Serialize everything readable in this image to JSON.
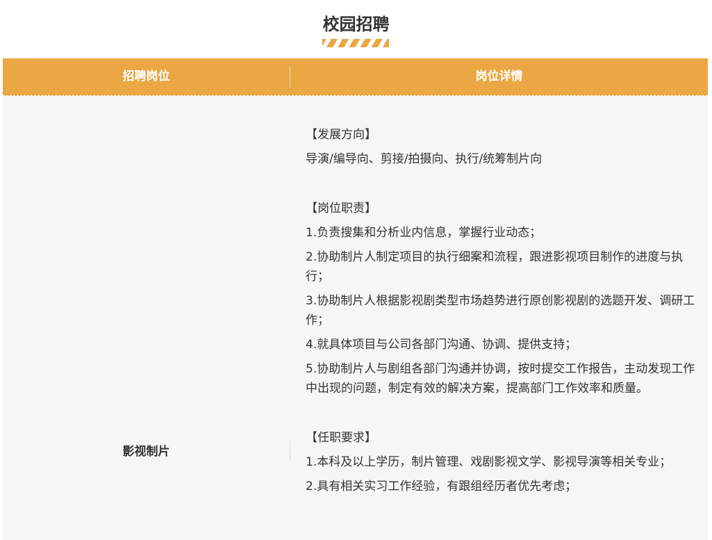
{
  "page": {
    "title": "校园招聘"
  },
  "table": {
    "headers": {
      "position": "招聘岗位",
      "details": "岗位详情"
    },
    "row": {
      "position": "影视制片",
      "direction_heading": "【发展方向】",
      "direction_text": "导演/编导向、剪接/拍摄向、执行/统筹制片向",
      "duties_heading": "【岗位职责】",
      "duties": [
        "1.负责搜集和分析业内信息，掌握行业动态；",
        "2.协助制片人制定项目的执行细案和流程，跟进影视项目制作的进度与执行；",
        "3.协助制片人根据影视剧类型市场趋势进行原创影视剧的选题开发、调研工作；",
        "4.就具体项目与公司各部门沟通、协调、提供支持；",
        "5.协助制片人与剧组各部门沟通并协调，按时提交工作报告，主动发现工作中出现的问题，制定有效的解决方案，提高部门工作效率和质量。"
      ],
      "requirements_heading": "【任职要求】",
      "requirements": [
        "1.本科及以上学历，制片管理、戏剧影视文学、影视导演等相关专业；",
        "2.具有相关实习工作经验，有跟组经历者优先考虑；"
      ]
    }
  },
  "colors": {
    "accent": "#eaa743",
    "body_bg": "#f6f6f6",
    "text": "#333333"
  }
}
